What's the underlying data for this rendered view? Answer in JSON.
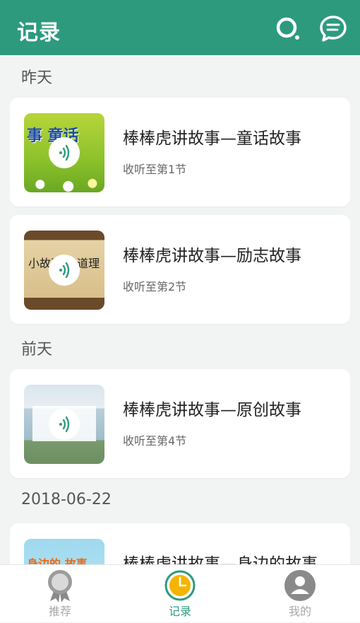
{
  "header": {
    "title": "记录"
  },
  "sections": [
    {
      "label": "昨天"
    },
    {
      "label": "前天"
    },
    {
      "label": "2018-06-22"
    }
  ],
  "items": [
    {
      "title": "棒棒虎讲故事—童话故事",
      "progress": "收听至第1节",
      "thumb_text": "事 童话"
    },
    {
      "title": "棒棒虎讲故事—励志故事",
      "progress": "收听至第2节",
      "thumb_text": "小故事 大道理"
    },
    {
      "title": "棒棒虎讲故事—原创故事",
      "progress": "收听至第4节"
    },
    {
      "title": "棒棒虎讲故事—身边的故事",
      "thumb_text": "身边的 故事"
    }
  ],
  "tabs": [
    {
      "label": "推荐",
      "icon": "medal-icon"
    },
    {
      "label": "记录",
      "icon": "clock-icon"
    },
    {
      "label": "我的",
      "icon": "user-icon"
    }
  ],
  "colors": {
    "brand": "#2d9a7e",
    "inactive": "#a8a8a8"
  }
}
